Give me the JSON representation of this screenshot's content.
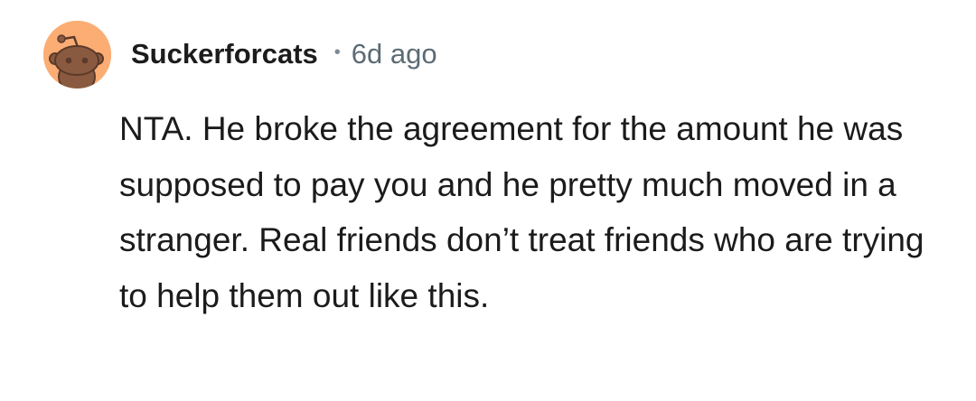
{
  "comment": {
    "author": "Suckerforcats",
    "separator": "•",
    "age": "6d ago",
    "avatar_icon": "reddit-snoo-avatar-icon",
    "avatar_color": "#fbad74",
    "body": "NTA. He broke the agreement for the amount he was supposed to pay you and he pretty much moved in a stranger. Real friends don’t treat friends who are trying to help them out like this."
  }
}
